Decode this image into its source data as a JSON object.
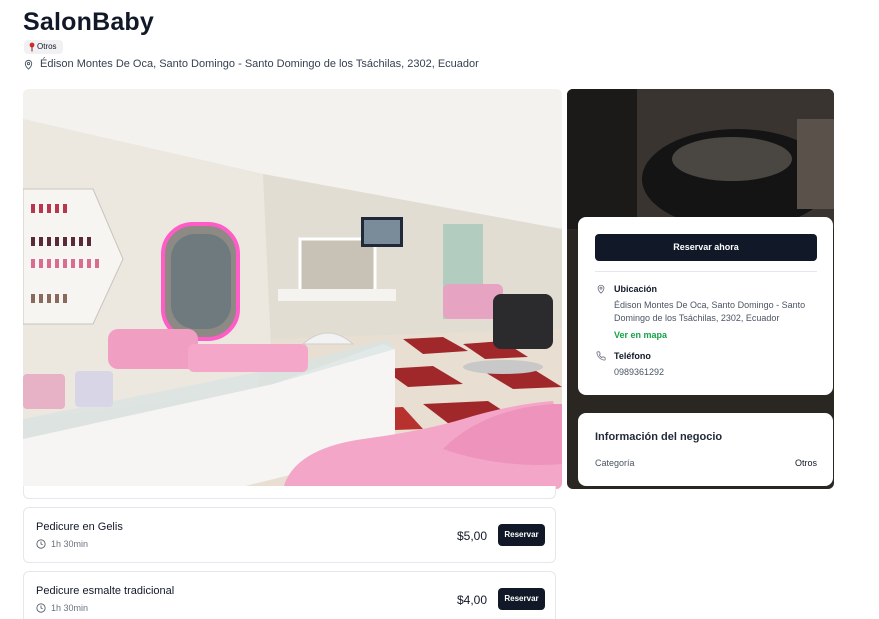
{
  "business": {
    "name": "SalonBaby",
    "category_badge": "Otros",
    "address": "Édison Montes De Oca, Santo Domingo - Santo Domingo de los Tsáchilas, 2302, Ecuador"
  },
  "gallery": {
    "main_image": "salon-interior-photo",
    "side_image": "salon-wash-station-photo"
  },
  "services": [
    {
      "name": "Pedicure en Gelis",
      "duration": "1h 30min",
      "price": "$5,00",
      "button": "Reservar"
    },
    {
      "name": "Pedicure esmalte tradicional",
      "duration": "1h 30min",
      "price": "$4,00",
      "button": "Reservar"
    }
  ],
  "booking": {
    "button": "Reservar ahora",
    "location_label": "Ubicación",
    "location_text": "Édison Montes De Oca, Santo Domingo - Santo Domingo de los Tsáchilas, 2302, Ecuador",
    "map_link": "Ver en mapa",
    "phone_label": "Teléfono",
    "phone": "0989361292"
  },
  "business_info": {
    "title": "Información del negocio",
    "category_label": "Categoría",
    "category_value": "Otros"
  },
  "colors": {
    "primary_dark": "#111827",
    "link_green": "#16a34a",
    "badge_pin": "#dc2626"
  },
  "icons": [
    "map-pin-icon",
    "clock-icon",
    "phone-icon"
  ]
}
